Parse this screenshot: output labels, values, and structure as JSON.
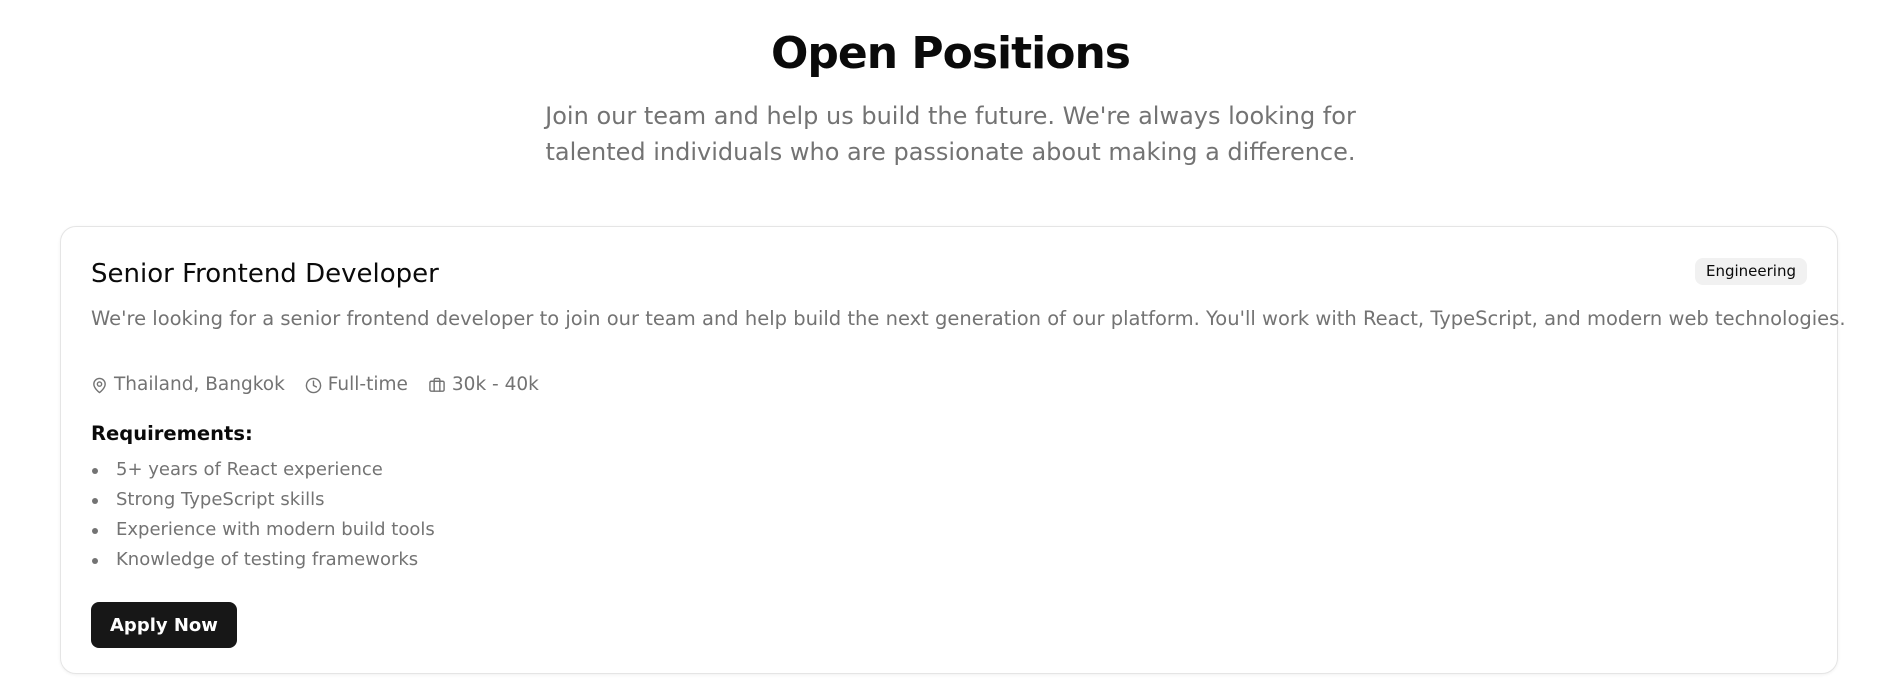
{
  "header": {
    "title": "Open Positions",
    "subtitle_line1": "Join our team and help us build the future. We're always looking for",
    "subtitle_line2": "talented individuals who are passionate about making a difference."
  },
  "jobs": [
    {
      "title": "Senior Frontend Developer",
      "department": "Engineering",
      "description": "We're looking for a senior frontend developer to join our team and help build the next generation of our platform. You'll work with React, TypeScript, and modern web technologies.",
      "location": "Thailand, Bangkok",
      "location_icon": "map-pin-icon",
      "employment_type": "Full-time",
      "employment_type_icon": "clock-icon",
      "salary": "30k - 40k",
      "salary_icon": "briefcase-icon",
      "requirements_heading": "Requirements:",
      "requirements": [
        "5+ years of React experience",
        "Strong TypeScript skills",
        "Experience with modern build tools",
        "Knowledge of testing frameworks"
      ],
      "apply_label": "Apply Now"
    }
  ],
  "colors": {
    "text_primary": "#0a0a0a",
    "text_muted": "#737373",
    "button_bg": "#171717",
    "badge_bg": "#f1f1f1",
    "card_border": "#e5e5e5"
  }
}
